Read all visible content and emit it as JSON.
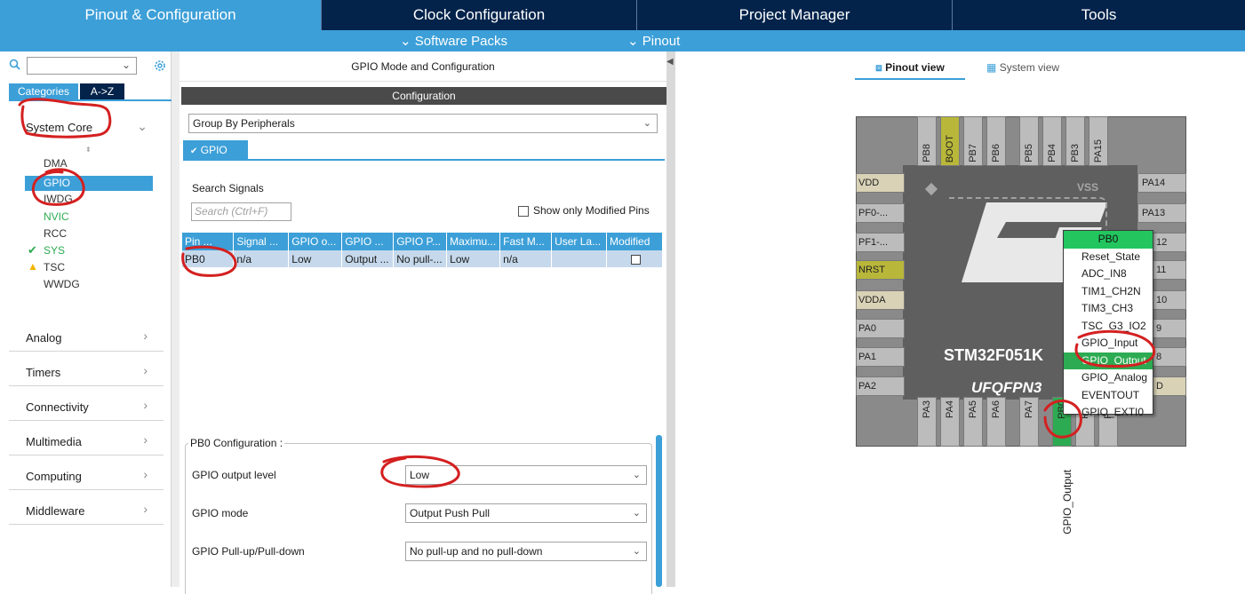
{
  "top_tabs": [
    {
      "label": "Pinout & Configuration",
      "active": true
    },
    {
      "label": "Clock Configuration",
      "active": false
    },
    {
      "label": "Project Manager",
      "active": false
    },
    {
      "label": "Tools",
      "active": false
    }
  ],
  "sub_menu": {
    "software_packs": "Software Packs",
    "pinout": "Pinout"
  },
  "left": {
    "search_placeholder": "",
    "tab_categories": "Categories",
    "tab_az": "A->Z",
    "system_core": "System Core",
    "peripherals": [
      {
        "label": "DMA",
        "state": "normal"
      },
      {
        "label": "GPIO",
        "state": "selected"
      },
      {
        "label": "IWDG",
        "state": "normal"
      },
      {
        "label": "NVIC",
        "state": "enabled"
      },
      {
        "label": "RCC",
        "state": "normal"
      },
      {
        "label": "SYS",
        "state": "ok"
      },
      {
        "label": "TSC",
        "state": "warning"
      },
      {
        "label": "WWDG",
        "state": "normal"
      }
    ],
    "categories": [
      "Analog",
      "Timers",
      "Connectivity",
      "Multimedia",
      "Computing",
      "Middleware"
    ]
  },
  "middle": {
    "title": "GPIO Mode and Configuration",
    "configuration_header": "Configuration",
    "group_by": "Group By Peripherals",
    "gpio_tab": "GPIO",
    "search_signals_label": "Search Signals",
    "search_placeholder": "Search (Ctrl+F)",
    "show_modified": "Show only Modified Pins",
    "table_headers": [
      "Pin ...",
      "Signal ...",
      "GPIO o...",
      "GPIO ...",
      "GPIO P...",
      "Maximu...",
      "Fast M...",
      "User La...",
      "Modified"
    ],
    "table_rows": [
      [
        "PB0",
        "n/a",
        "Low",
        "Output ...",
        "No pull-...",
        "Low",
        "n/a",
        "",
        ""
      ]
    ],
    "pb0_config_title": "PB0 Configuration :",
    "config_rows": [
      {
        "label": "GPIO output level",
        "value": "Low"
      },
      {
        "label": "GPIO mode",
        "value": "Output Push Pull"
      },
      {
        "label": "GPIO Pull-up/Pull-down",
        "value": "No pull-up and no pull-down"
      }
    ]
  },
  "right": {
    "pinout_view": "Pinout view",
    "system_view": "System view",
    "chip_name": "STM32F051K",
    "package": "UFQFPN3",
    "vss": "VSS",
    "top_pins": [
      "PB8",
      "BOOT",
      "PB7",
      "PB6",
      "PB5",
      "PB4",
      "PB3",
      "PA15"
    ],
    "bottom_pins": [
      "PA3",
      "PA4",
      "PA5",
      "PA6",
      "PA7",
      "PB0",
      "PB1",
      "PB2"
    ],
    "left_pins": [
      "VDD",
      "PF0-...",
      "PF1-...",
      "NRST",
      "VDDA",
      "PA0",
      "PA1",
      "PA2"
    ],
    "right_pins": [
      "PA14",
      "PA13",
      "12",
      "11",
      "10",
      "9",
      "8",
      "D"
    ],
    "pin_signal_label": "GPIO_Output",
    "context_menu": {
      "header": "PB0",
      "items": [
        "Reset_State",
        "ADC_IN8",
        "TIM1_CH2N",
        "TIM3_CH3",
        "TSC_G3_IO2",
        "GPIO_Input",
        "GPIO_Output",
        "GPIO_Analog",
        "EVENTOUT",
        "GPIO_EXTI0"
      ],
      "selected": "GPIO_Output"
    }
  },
  "colors": {
    "nav_dark": "#03234b",
    "accent_blue": "#3c9fd8",
    "selected_green": "#2dab52",
    "annotation_red": "#d42020"
  }
}
